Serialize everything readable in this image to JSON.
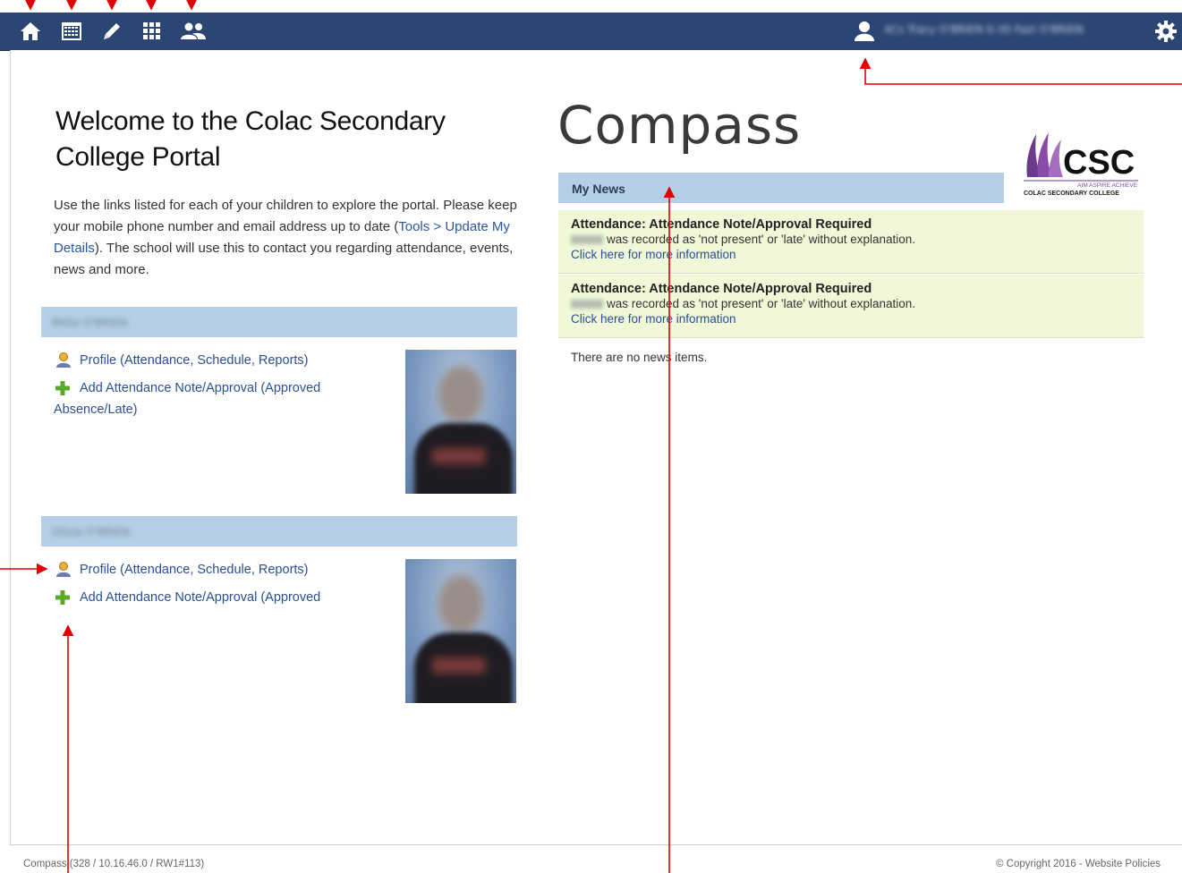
{
  "nav": {
    "icons": [
      "home-icon",
      "calendar-icon",
      "pencil-icon",
      "grid-icon",
      "people-icon"
    ],
    "user_name": "4Cs Tracy O'BRIEN 0:30 Fast O'BRIEN",
    "accent": "#2b4673"
  },
  "welcome": {
    "title": "Welcome to the Colac Secondary College Portal",
    "intro_before": "Use the links listed for each of your children to explore the portal. Please keep your mobile phone number and email address up to date (",
    "intro_link": "Tools > Update My Details",
    "intro_after": "). The school will use this to contact you regarding attendance, events, news and more."
  },
  "children": [
    {
      "name": "Millie O'BRIEN",
      "profile_link": "Profile (Attendance, Schedule, Reports)",
      "note_link": "Add Attendance Note/Approval (Approved Absence/Late)"
    },
    {
      "name": "Olivia O'BRIEN",
      "profile_link": "Profile (Attendance, Schedule, Reports)",
      "note_link": "Add Attendance Note/Approval (Approved"
    }
  ],
  "brand": {
    "compass": "Compass",
    "csc_letters": "CSC",
    "csc_tagline": "AIM ASPIRE ACHIEVE",
    "csc_school": "COLAC SECONDARY COLLEGE"
  },
  "news": {
    "header": "My News",
    "items": [
      {
        "title": "Attendance: Attendance Note/Approval Required",
        "text": "was recorded as 'not present' or 'late' without explanation.",
        "link": "Click here for more information"
      },
      {
        "title": "Attendance: Attendance Note/Approval Required",
        "text": "was recorded as 'not present' or 'late' without explanation.",
        "link": "Click here for more information"
      }
    ],
    "empty_text": "There are no news items."
  },
  "footer": {
    "version": "Compass (328 / 10.16.46.0 / RW1#113)",
    "copyright": "© Copyright 2016 - Website Policies"
  },
  "colors": {
    "annotation_arrow": "#e00000",
    "header_bar": "#b6cfe6",
    "news_bg": "#f0f8d8"
  }
}
